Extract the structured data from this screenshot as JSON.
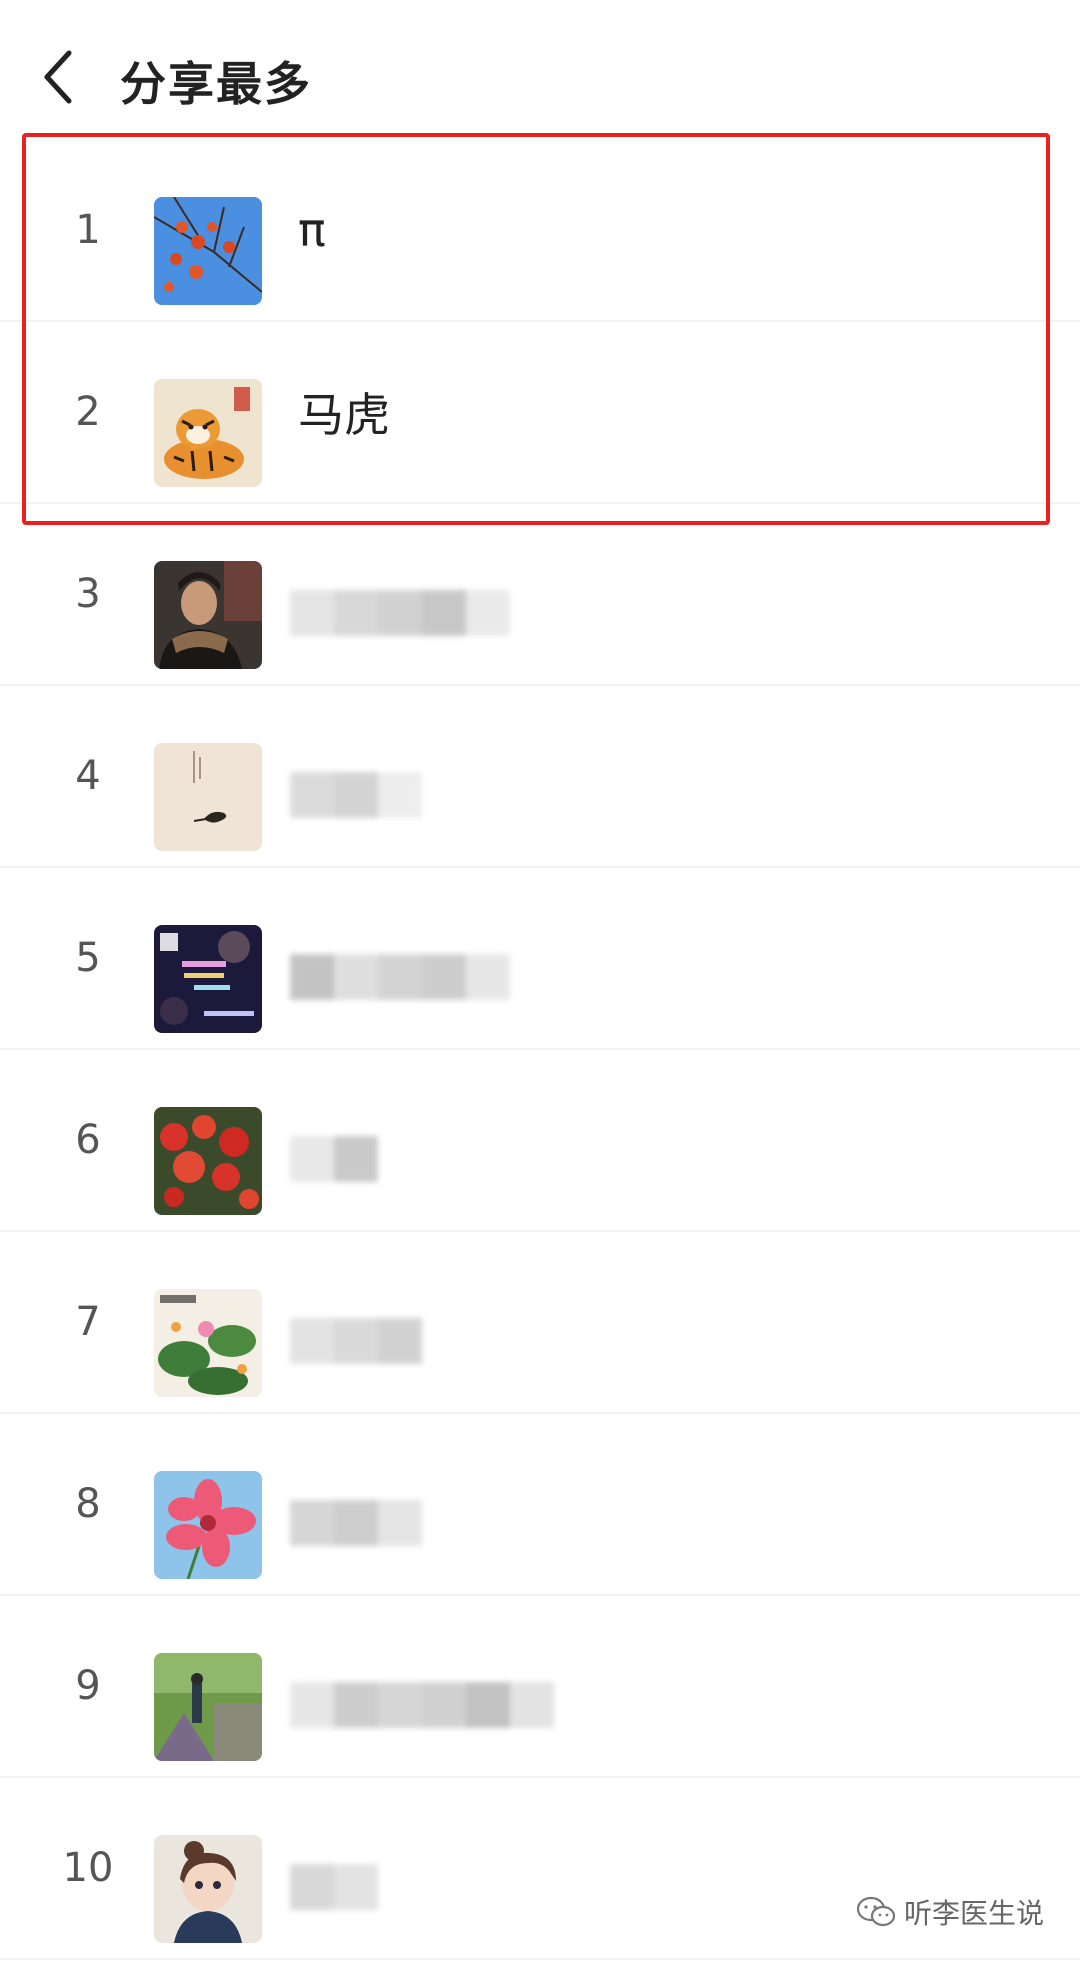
{
  "header": {
    "back_icon": "chevron-left-icon",
    "title": "分享最多"
  },
  "users": [
    {
      "rank": "1",
      "name": "π",
      "avatar": "persimmon-branch-avatar"
    },
    {
      "rank": "2",
      "name": "马虎",
      "avatar": "tiger-avatar"
    },
    {
      "rank": "3",
      "name": "",
      "avatar": "portrait-avatar"
    },
    {
      "rank": "4",
      "name": "",
      "avatar": "ink-painting-avatar"
    },
    {
      "rank": "5",
      "name": "",
      "avatar": "text-collage-avatar"
    },
    {
      "rank": "6",
      "name": "",
      "avatar": "red-flowers-avatar"
    },
    {
      "rank": "7",
      "name": "",
      "avatar": "lotus-painting-avatar"
    },
    {
      "rank": "8",
      "name": "",
      "avatar": "pink-flower-avatar"
    },
    {
      "rank": "9",
      "name": "",
      "avatar": "garden-photo-avatar"
    },
    {
      "rank": "10",
      "name": "",
      "avatar": "cartoon-girl-avatar"
    }
  ],
  "watermark": {
    "icon": "wechat-icon",
    "text": "听李医生说"
  },
  "colors": {
    "highlight": "#e8231f",
    "divider": "#f1f1f1",
    "rank_text": "#555555"
  }
}
